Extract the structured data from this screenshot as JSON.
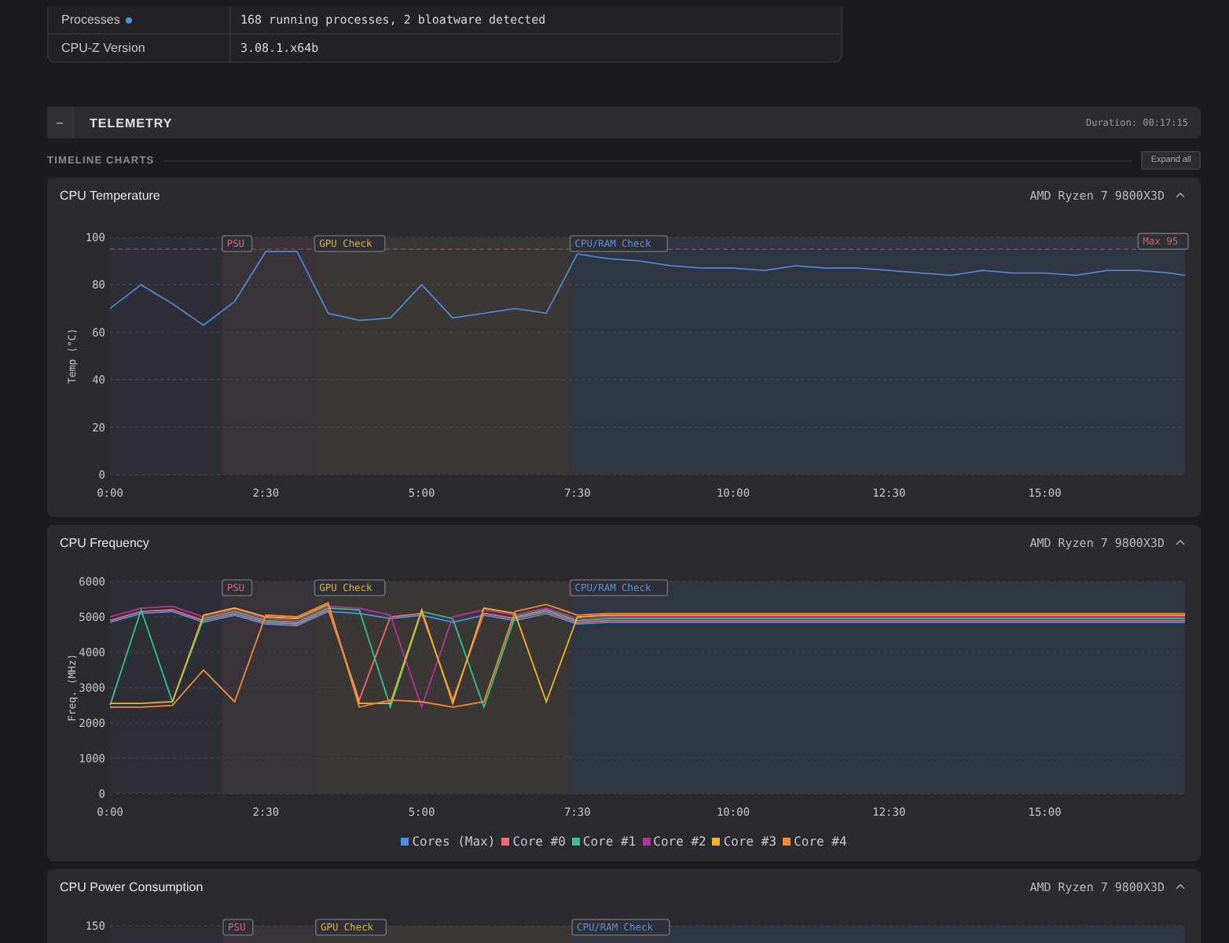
{
  "system_table": {
    "rows": [
      {
        "label": "Processes",
        "color": "#4a8fe0",
        "value": "168 running processes, 2 bloatware detected"
      },
      {
        "label": "CPU-Z Version",
        "value": "3.08.1.x64b"
      }
    ]
  },
  "telemetry": {
    "toggle": "−",
    "title": "TELEMETRY",
    "duration": "Duration: 00:17:15",
    "section_label": "TIMELINE CHARTS",
    "expand_button": "Expand all",
    "charts": [
      {
        "title": "CPU Temperature",
        "device": "AMD Ryzen 7 9800X3D",
        "expanded": true,
        "chart_data": {
          "type": "line",
          "ylabel": "Temp (°C)",
          "grid": true,
          "x": [
            0,
            30,
            60,
            90,
            120,
            150,
            180,
            210,
            240,
            270,
            300,
            330,
            360,
            390,
            420,
            450,
            480,
            510,
            540,
            570,
            600,
            630,
            660,
            690,
            720,
            750,
            780,
            810,
            840,
            870,
            900,
            930,
            960,
            990,
            1020,
            1035
          ],
          "xlim": [
            0,
            1035
          ],
          "ylim": [
            0,
            100
          ],
          "xticks": [
            {
              "value": 0,
              "label": "0:00"
            },
            {
              "value": 150,
              "label": "2:30"
            },
            {
              "value": 300,
              "label": "5:00"
            },
            {
              "value": 450,
              "label": "7:30"
            },
            {
              "value": 600,
              "label": "10:00"
            },
            {
              "value": 750,
              "label": "12:30"
            },
            {
              "value": 900,
              "label": "15:00"
            }
          ],
          "yticks": [
            0,
            20,
            40,
            60,
            80,
            100
          ],
          "series": [
            {
              "color": "#4f86d6",
              "values": [
                70,
                80,
                72,
                63,
                73,
                94,
                94,
                68,
                65,
                66,
                80,
                66,
                68,
                70,
                68,
                93,
                91,
                90,
                88,
                87,
                87,
                86,
                88,
                87,
                87,
                86,
                85,
                84,
                86,
                85,
                85,
                84,
                86,
                86,
                85,
                84
              ]
            }
          ]
        },
        "phases": [
          {
            "label": "PSU",
            "color": "#e0606a"
          },
          {
            "label": "GPU Check",
            "color": "#e0b030"
          },
          {
            "label": "CPU/RAM Check",
            "color": "#5b8fe0"
          }
        ],
        "limit": {
          "label": "Max 95",
          "color": "#d0606a"
        }
      },
      {
        "title": "CPU Frequency",
        "device": "AMD Ryzen 7 9800X3D",
        "expanded": true,
        "chart_data": {
          "type": "line",
          "ylabel": "Freq. (MHz)",
          "grid": true,
          "x": [
            0,
            30,
            60,
            90,
            120,
            150,
            180,
            210,
            240,
            270,
            300,
            330,
            360,
            390,
            420,
            450,
            480,
            510,
            540,
            570,
            600,
            630,
            660,
            690,
            720,
            750,
            780,
            810,
            840,
            870,
            900,
            930,
            960,
            990,
            1020,
            1035
          ],
          "xlim": [
            0,
            1035
          ],
          "ylim": [
            0,
            6000
          ],
          "xticks": [
            {
              "value": 0,
              "label": "0:00"
            },
            {
              "value": 150,
              "label": "2:30"
            },
            {
              "value": 300,
              "label": "5:00"
            },
            {
              "value": 450,
              "label": "7:30"
            },
            {
              "value": 600,
              "label": "10:00"
            },
            {
              "value": 750,
              "label": "12:30"
            },
            {
              "value": 900,
              "label": "15:00"
            }
          ],
          "yticks": [
            0,
            1000,
            2000,
            3000,
            4000,
            5000,
            6000
          ],
          "series": [
            {
              "name": "Cores (Max)",
              "color": "#4f8fe8",
              "values": [
                4850,
                5100,
                5150,
                4850,
                5050,
                4800,
                4750,
                5150,
                5100,
                4950,
                5050,
                4850,
                5050,
                4900,
                5100,
                4800,
                4850,
                4850,
                4850,
                4850,
                4850,
                4850,
                4850,
                4850,
                4850,
                4850,
                4850,
                4850,
                4850,
                4850,
                4850,
                4850,
                4850,
                4850,
                4850,
                4850
              ]
            },
            {
              "name": "Core #0",
              "color": "#f06b6b",
              "values": [
                4900,
                5150,
                5200,
                4900,
                5100,
                4850,
                4800,
                5200,
                2650,
                5000,
                5100,
                2650,
                5100,
                4950,
                5150,
                4850,
                4900,
                4900,
                4900,
                4900,
                4900,
                4900,
                4900,
                4900,
                4900,
                4900,
                4900,
                4900,
                4900,
                4900,
                4900,
                4900,
                4900,
                4900,
                4900,
                4900
              ]
            },
            {
              "name": "Core #1",
              "color": "#34c48b",
              "values": [
                2500,
                5200,
                2600,
                4950,
                5150,
                4900,
                4850,
                5250,
                5200,
                2450,
                5150,
                4950,
                2450,
                5000,
                5200,
                4900,
                4950,
                4950,
                4950,
                4950,
                4950,
                4950,
                4950,
                4950,
                4950,
                4950,
                4950,
                4950,
                4950,
                4950,
                4950,
                4950,
                4950,
                4950,
                4950,
                4950
              ]
            },
            {
              "name": "Core #2",
              "color": "#b5339d",
              "values": [
                5000,
                5250,
                5300,
                5000,
                5200,
                4950,
                4900,
                5300,
                5250,
                5050,
                2450,
                5000,
                5200,
                5050,
                5250,
                4950,
                5000,
                5000,
                5000,
                5000,
                5000,
                5000,
                5000,
                5000,
                5000,
                5000,
                5000,
                5000,
                5000,
                5000,
                5000,
                5000,
                5000,
                5000,
                5000,
                5000
              ]
            },
            {
              "name": "Core #3",
              "color": "#f0b429",
              "values": [
                2550,
                2550,
                2600,
                5050,
                5250,
                5000,
                4950,
                5350,
                2550,
                2550,
                5200,
                2550,
                5250,
                5100,
                2600,
                5000,
                5050,
                5050,
                5050,
                5050,
                5050,
                5050,
                5050,
                5050,
                5050,
                5050,
                5050,
                5050,
                5050,
                5050,
                5050,
                5050,
                5050,
                5050,
                5050,
                5050
              ]
            },
            {
              "name": "Core #4",
              "color": "#f08a3c",
              "values": [
                2450,
                2450,
                2500,
                3500,
                2600,
                5050,
                5000,
                5400,
                2450,
                2650,
                2600,
                2450,
                2600,
                5150,
                5350,
                5050,
                5100,
                5100,
                5100,
                5100,
                5100,
                5100,
                5100,
                5100,
                5100,
                5100,
                5100,
                5100,
                5100,
                5100,
                5100,
                5100,
                5100,
                5100,
                5100,
                5100
              ]
            }
          ]
        },
        "phases": [
          {
            "label": "PSU",
            "color": "#e0606a"
          },
          {
            "label": "GPU Check",
            "color": "#e0b030"
          },
          {
            "label": "CPU/RAM Check",
            "color": "#5b8fe0"
          }
        ]
      },
      {
        "title": "CPU Power Consumption",
        "device": "AMD Ryzen 7 9800X3D",
        "expanded": true,
        "axis_label": "150",
        "phases": [
          {
            "label": "PSU",
            "color": "#e0606a"
          },
          {
            "label": "GPU Check",
            "color": "#e0b030"
          },
          {
            "label": "CPU/RAM Check",
            "color": "#5b8fe0"
          }
        ]
      }
    ]
  }
}
